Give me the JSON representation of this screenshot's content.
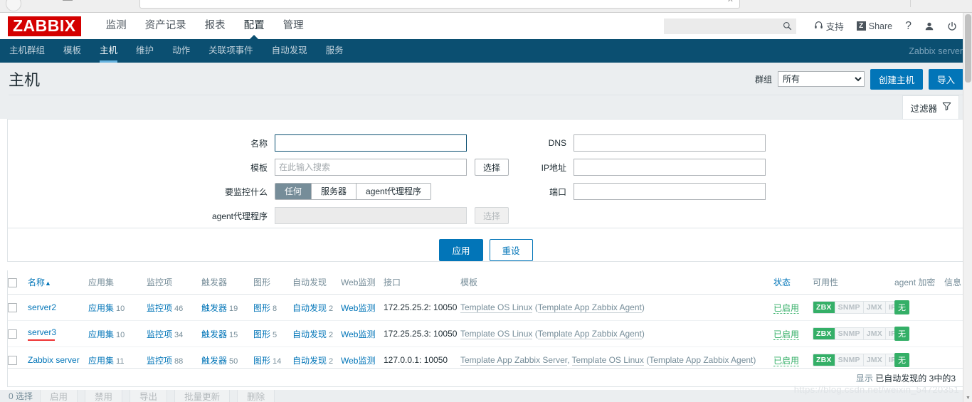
{
  "browser": {
    "omnibox_value": ""
  },
  "topnav": {
    "logo": "ZABBIX",
    "items": [
      {
        "label": "监测",
        "active": false
      },
      {
        "label": "资产记录",
        "active": false
      },
      {
        "label": "报表",
        "active": false
      },
      {
        "label": "配置",
        "active": true
      },
      {
        "label": "管理",
        "active": false
      }
    ],
    "search": {
      "value": "",
      "placeholder": ""
    },
    "support_label": "支持",
    "share_label": "Share",
    "share_badge": "Z",
    "help_label": "?",
    "icons": {
      "search": "search-icon",
      "headset": "headset-icon",
      "user": "user-icon",
      "power": "power-icon"
    }
  },
  "subnav": {
    "items": [
      {
        "label": "主机群组",
        "active": false
      },
      {
        "label": "模板",
        "active": false
      },
      {
        "label": "主机",
        "active": true
      },
      {
        "label": "维护",
        "active": false
      },
      {
        "label": "动作",
        "active": false
      },
      {
        "label": "关联项事件",
        "active": false
      },
      {
        "label": "自动发现",
        "active": false
      },
      {
        "label": "服务",
        "active": false
      }
    ],
    "server_label": "Zabbix server"
  },
  "header": {
    "title": "主机",
    "group_label": "群组",
    "group_value": "所有",
    "group_options": [
      "所有"
    ],
    "create_host_label": "创建主机",
    "import_label": "导入"
  },
  "filter": {
    "tab_label": "过滤器",
    "fields": {
      "name_label": "名称",
      "name_value": "",
      "template_label": "模板",
      "template_value": "",
      "template_placeholder": "在此输入搜索",
      "template_select_label": "选择",
      "monitored_by_label": "要监控什么",
      "monitored_by_options": [
        "任何",
        "服务器",
        "agent代理程序"
      ],
      "monitored_by_selected": "任何",
      "proxy_label": "agent代理程序",
      "proxy_value": "",
      "proxy_select_label": "选择",
      "dns_label": "DNS",
      "dns_value": "",
      "ip_label": "IP地址",
      "ip_value": "",
      "port_label": "端口",
      "port_value": ""
    },
    "apply_label": "应用",
    "reset_label": "重设"
  },
  "table": {
    "columns": [
      "名称",
      "应用集",
      "监控项",
      "触发器",
      "图形",
      "自动发现",
      "Web监测",
      "接口",
      "模板",
      "状态",
      "可用性",
      "agent 加密",
      "信息"
    ],
    "sort_column": "名称",
    "sort_direction": "asc",
    "sort_arrow": "▲",
    "rows": [
      {
        "name": "server2",
        "applications": {
          "label": "应用集",
          "count": "10"
        },
        "items": {
          "label": "监控项",
          "count": "46"
        },
        "triggers": {
          "label": "触发器",
          "count": "19"
        },
        "graphs": {
          "label": "图形",
          "count": "8"
        },
        "discovery": {
          "label": "自动发现",
          "count": "2"
        },
        "web": {
          "label": "Web监测",
          "count": ""
        },
        "interface": "172.25.25.2: 10050",
        "templates": [
          {
            "text": "Template OS Linux",
            "link": true
          },
          {
            "text": " (",
            "link": false
          },
          {
            "text": "Template App Zabbix Agent",
            "link": true
          },
          {
            "text": ")",
            "link": false
          }
        ],
        "status": "已启用",
        "availability": [
          {
            "label": "ZBX",
            "active": true
          },
          {
            "label": "SNMP",
            "active": false
          },
          {
            "label": "JMX",
            "active": false
          },
          {
            "label": "IPMI",
            "active": false
          }
        ],
        "encryption": "无",
        "info": "",
        "underline": false
      },
      {
        "name": "server3",
        "applications": {
          "label": "应用集",
          "count": "10"
        },
        "items": {
          "label": "监控项",
          "count": "34"
        },
        "triggers": {
          "label": "触发器",
          "count": "15"
        },
        "graphs": {
          "label": "图形",
          "count": "5"
        },
        "discovery": {
          "label": "自动发现",
          "count": "2"
        },
        "web": {
          "label": "Web监测",
          "count": ""
        },
        "interface": "172.25.25.3: 10050",
        "templates": [
          {
            "text": "Template OS Linux",
            "link": true
          },
          {
            "text": " (",
            "link": false
          },
          {
            "text": "Template App Zabbix Agent",
            "link": true
          },
          {
            "text": ")",
            "link": false
          }
        ],
        "status": "已启用",
        "availability": [
          {
            "label": "ZBX",
            "active": true
          },
          {
            "label": "SNMP",
            "active": false
          },
          {
            "label": "JMX",
            "active": false
          },
          {
            "label": "IPMI",
            "active": false
          }
        ],
        "encryption": "无",
        "info": "",
        "underline": true
      },
      {
        "name": "Zabbix server",
        "applications": {
          "label": "应用集",
          "count": "11"
        },
        "items": {
          "label": "监控项",
          "count": "88"
        },
        "triggers": {
          "label": "触发器",
          "count": "50"
        },
        "graphs": {
          "label": "图形",
          "count": "14"
        },
        "discovery": {
          "label": "自动发现",
          "count": "2"
        },
        "web": {
          "label": "Web监测",
          "count": ""
        },
        "interface": "127.0.0.1: 10050",
        "templates": [
          {
            "text": "Template App Zabbix Server",
            "link": true
          },
          {
            "text": ", ",
            "link": false
          },
          {
            "text": "Template OS Linux",
            "link": true
          },
          {
            "text": " (",
            "link": false
          },
          {
            "text": "Template App Zabbix Agent",
            "link": true
          },
          {
            "text": ")",
            "link": false
          }
        ],
        "status": "已启用",
        "availability": [
          {
            "label": "ZBX",
            "active": true
          },
          {
            "label": "SNMP",
            "active": false
          },
          {
            "label": "JMX",
            "active": false
          },
          {
            "label": "IPMI",
            "active": false
          }
        ],
        "encryption": "无",
        "info": "",
        "underline": false
      }
    ]
  },
  "footer": {
    "showing_prefix": "显示",
    "showing_text": "已自动发现的",
    "showing_count": "3中的3",
    "selected_count": "0 选择",
    "actions": [
      "启用",
      "禁用",
      "导出",
      "批量更新",
      "删除"
    ]
  },
  "watermark": "https://blog.csdn.net/weixin_54720351",
  "colors": {
    "brand_red": "#d40000",
    "nav_blue": "#0b4f71",
    "accent_blue": "#0275b8",
    "green": "#34af67",
    "muted": "#768d99"
  }
}
